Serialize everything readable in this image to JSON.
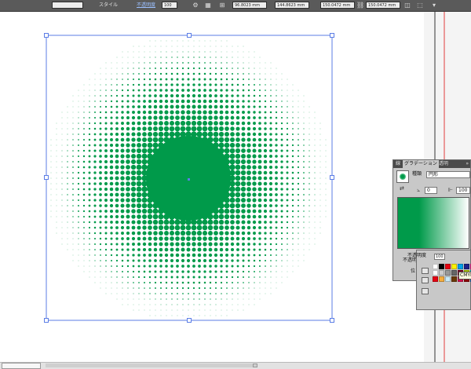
{
  "toolbar": {
    "style_label": "スタイル",
    "opacity_link": "不透明度",
    "opacity_value": "100",
    "x_value": "96.8023 mm",
    "y_value": "144.8623 mm",
    "w_value": "150.0472 mm",
    "h_value": "150.0472 mm"
  },
  "artwork": {
    "color": "#009a4a",
    "selection_color": "#5b7de6",
    "guide_color": "#e23b3b"
  },
  "gradient_panel": {
    "tabs": [
      "線",
      "グラデーション",
      "透明"
    ],
    "type_label": "種類",
    "type_value": "円形",
    "angle_value": "0",
    "ratio_value": "100",
    "opacity_label": "不透明度",
    "location_label": "位",
    "menu_icon": "panel-menu-icon"
  },
  "swatch_panel": {
    "opacity_label": "不透明度",
    "opacity_value": "100",
    "tooltip": "CMYK"
  },
  "swatches": [
    "#ffffff",
    "#000000",
    "#e60012",
    "#fff100",
    "#00a0e9",
    "#1d2088",
    "#e4007f",
    "#009944",
    "#f39800",
    "#8fc31f",
    "#ffffff",
    "#cccccc",
    "#999999",
    "#666666",
    "#7d0022",
    "#b5d100",
    "#00a7a0",
    "#0068b7",
    "#920783",
    "#ef857d",
    "#e60012",
    "#f6ad3c",
    "#c9e9f6",
    "#6a3906",
    "#d0104c",
    "#8b0000",
    "#00479d",
    "#f8b500",
    "#00913a",
    "#ffe100"
  ]
}
